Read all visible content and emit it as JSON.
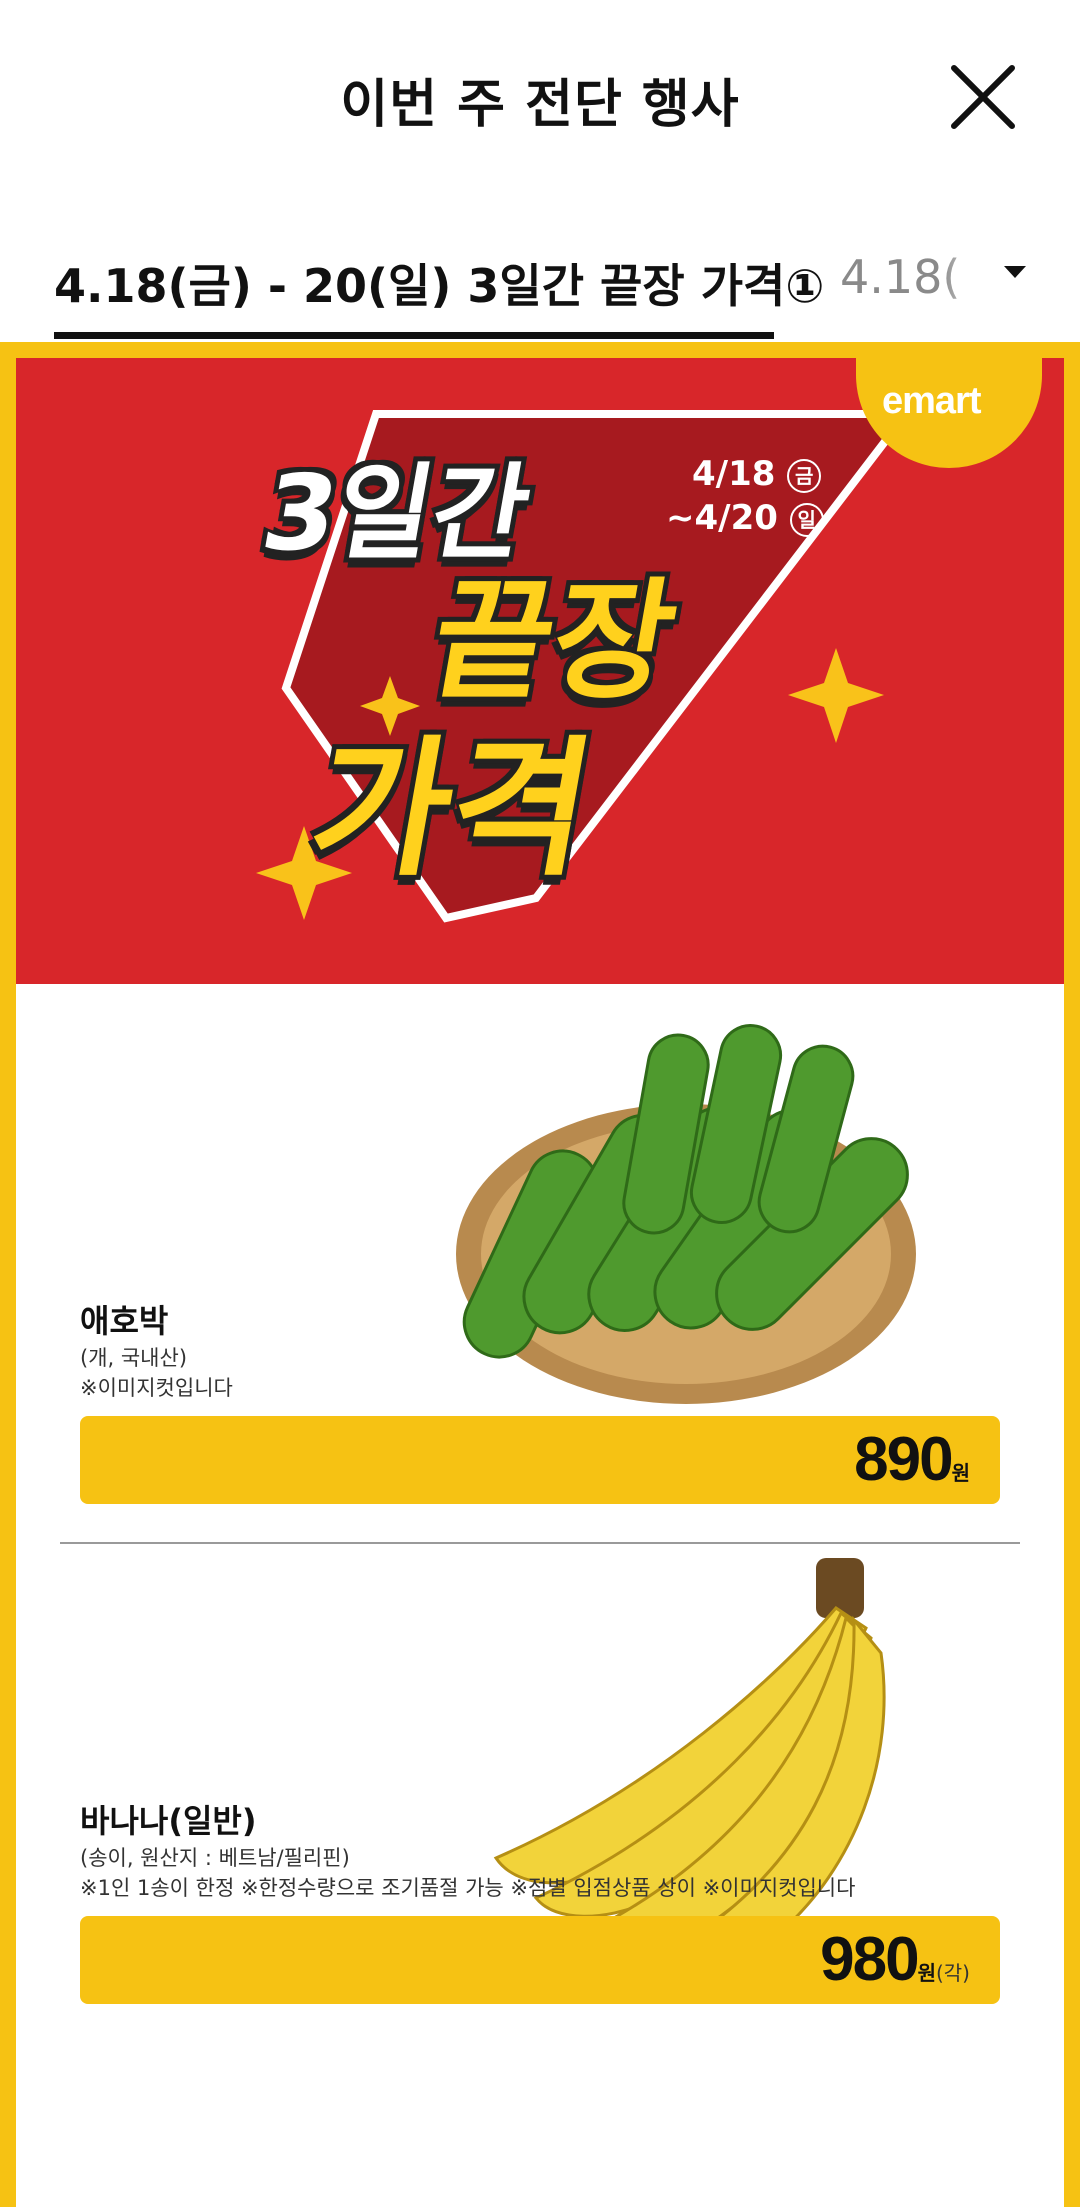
{
  "header": {
    "title": "이번 주 전단 행사"
  },
  "tabs": [
    {
      "label": "4.18(금) - 20(일) 3일간 끝장 가격①"
    },
    {
      "label": "4.18("
    }
  ],
  "banner": {
    "brand": "emart",
    "headline_1": "3일간",
    "headline_2": "끝장",
    "headline_3": "가격",
    "date_start": "4/18",
    "day_start": "금",
    "date_end": "~4/20",
    "day_end": "일"
  },
  "products": [
    {
      "name": "애호박",
      "sub1": "(개, 국내산)",
      "sub2": "※이미지컷입니다",
      "price": "890",
      "unit": "원",
      "unit_suffix": ""
    },
    {
      "name": "바나나(일반)",
      "sub1": "(송이, 원산지 : 베트남/필리핀)",
      "sub2": "※1인 1송이 한정 ※한정수량으로 조기품절 가능 ※점별 입점상품 상이 ※이미지컷입니다",
      "price": "980",
      "unit": "원",
      "unit_suffix": "(각)"
    }
  ],
  "colors": {
    "accent_yellow": "#f6c213",
    "banner_red": "#d8262a"
  }
}
